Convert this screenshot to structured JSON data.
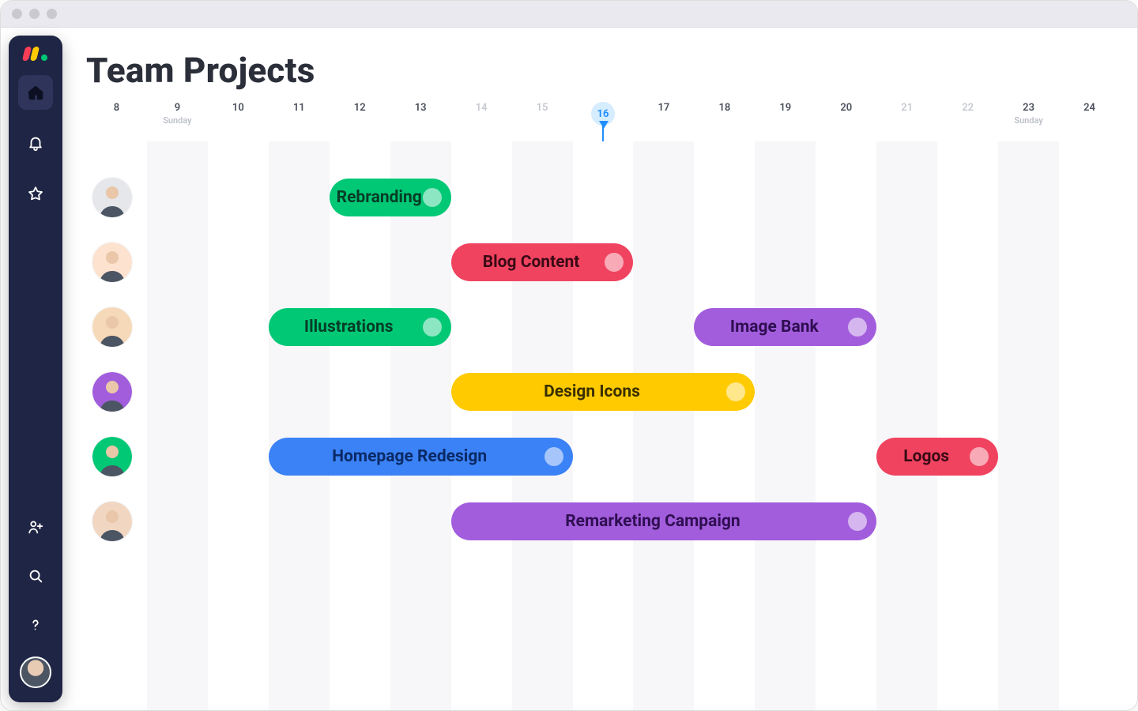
{
  "window": {
    "title": "Team Projects"
  },
  "timeline": {
    "days": [
      {
        "n": "8",
        "sub": "",
        "muted": false
      },
      {
        "n": "9",
        "sub": "Sunday",
        "muted": false
      },
      {
        "n": "10",
        "sub": "",
        "muted": false
      },
      {
        "n": "11",
        "sub": "",
        "muted": false
      },
      {
        "n": "12",
        "sub": "",
        "muted": false
      },
      {
        "n": "13",
        "sub": "",
        "muted": false
      },
      {
        "n": "14",
        "sub": "",
        "muted": true
      },
      {
        "n": "15",
        "sub": "",
        "muted": true
      },
      {
        "n": "16",
        "sub": "",
        "muted": false,
        "today": true
      },
      {
        "n": "17",
        "sub": "",
        "muted": false
      },
      {
        "n": "18",
        "sub": "",
        "muted": false
      },
      {
        "n": "19",
        "sub": "",
        "muted": false
      },
      {
        "n": "20",
        "sub": "",
        "muted": false
      },
      {
        "n": "21",
        "sub": "",
        "muted": true
      },
      {
        "n": "22",
        "sub": "",
        "muted": true
      },
      {
        "n": "23",
        "sub": "Sunday",
        "muted": false
      },
      {
        "n": "24",
        "sub": "",
        "muted": false
      }
    ],
    "today_index": 8
  },
  "people": [
    {
      "id": "p1",
      "bg": "#e5e7eb",
      "ring": "#ffffff"
    },
    {
      "id": "p2",
      "bg": "#fde2cf",
      "ring": "#ffffff"
    },
    {
      "id": "p3",
      "bg": "#f6d9b8",
      "ring": "#ffffff"
    },
    {
      "id": "p4",
      "bg": "#a25ddc",
      "ring": "#ffffff"
    },
    {
      "id": "p5",
      "bg": "#00c875",
      "ring": "#ffffff"
    },
    {
      "id": "p6",
      "bg": "#f1d6c2",
      "ring": "#ffffff"
    }
  ],
  "tasks": [
    {
      "row": 0,
      "label": "Rebranding",
      "color": "green",
      "start": 12,
      "end": 14
    },
    {
      "row": 1,
      "label": "Blog Content",
      "color": "red",
      "start": 14,
      "end": 17
    },
    {
      "row": 2,
      "label": "Illustrations",
      "color": "green",
      "start": 11,
      "end": 14
    },
    {
      "row": 2,
      "label": "Image Bank",
      "color": "purple",
      "start": 18,
      "end": 21
    },
    {
      "row": 3,
      "label": "Design Icons",
      "color": "yellow",
      "start": 14,
      "end": 19
    },
    {
      "row": 4,
      "label": "Homepage Redesign",
      "color": "blue",
      "start": 11,
      "end": 16
    },
    {
      "row": 4,
      "label": "Logos",
      "color": "red",
      "start": 21,
      "end": 23
    },
    {
      "row": 5,
      "label": "Remarketing Campaign",
      "color": "purple",
      "start": 14,
      "end": 21
    }
  ],
  "sidebar": {
    "items": [
      {
        "id": "home",
        "active": true
      },
      {
        "id": "notifications",
        "active": false
      },
      {
        "id": "favorites",
        "active": false
      }
    ],
    "bottom": [
      {
        "id": "invite"
      },
      {
        "id": "search"
      },
      {
        "id": "help"
      }
    ]
  },
  "colors": {
    "green": "#00c875",
    "red": "#f04360",
    "blue": "#3b82f6",
    "yellow": "#ffcb00",
    "purple": "#a25ddc",
    "today": "#1f8fff",
    "sidebar": "#1f2544"
  }
}
